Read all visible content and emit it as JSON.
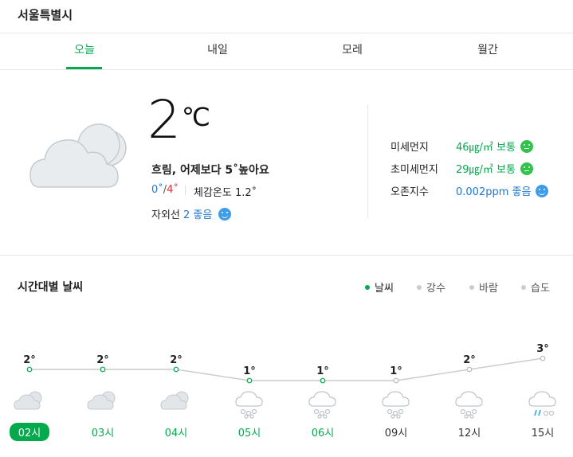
{
  "location": "서울특별시",
  "tabs": [
    {
      "label": "오늘",
      "active": true
    },
    {
      "label": "내일",
      "active": false
    },
    {
      "label": "모레",
      "active": false
    },
    {
      "label": "월간",
      "active": false
    }
  ],
  "current": {
    "icon": "cloudy-icon",
    "temperature": "2",
    "unit": "℃",
    "summary": "흐림, 어제보다 5˚높아요",
    "min_temp": "0˚",
    "slash": "/",
    "max_temp": "4˚",
    "feels_like": "체감온도 1.2˚",
    "uv_label": "자외선",
    "uv_value": "2 좋음"
  },
  "air_quality": [
    {
      "label": "미세먼지",
      "value": "46㎍/㎥ 보통",
      "status": "normal",
      "color": "#32c24d"
    },
    {
      "label": "초미세먼지",
      "value": "29㎍/㎥ 보통",
      "status": "normal",
      "color": "#32c24d"
    },
    {
      "label": "오존지수",
      "value": "0.002ppm 좋음",
      "status": "good",
      "color": "#3f9de8"
    }
  ],
  "hourly": {
    "title": "시간대별 날씨",
    "legend": [
      {
        "label": "날씨",
        "active": true
      },
      {
        "label": "강수",
        "active": false
      },
      {
        "label": "바람",
        "active": false
      },
      {
        "label": "습도",
        "active": false
      }
    ]
  },
  "chart_data": {
    "type": "line",
    "categories": [
      "02시",
      "03시",
      "04시",
      "05시",
      "06시",
      "09시",
      "12시",
      "15시"
    ],
    "values": [
      2,
      2,
      2,
      1,
      1,
      1,
      2,
      3
    ],
    "value_labels": [
      "2°",
      "2°",
      "2°",
      "1°",
      "1°",
      "1°",
      "2°",
      "3°"
    ],
    "icons": [
      "cloudy-icon",
      "cloudy-icon",
      "cloudy-icon",
      "snow-icon",
      "snow-icon",
      "snow-icon",
      "snow-icon",
      "rain-snow-icon"
    ],
    "current_index": 0,
    "today_indices": [
      0,
      1,
      2,
      3,
      4
    ],
    "line_color": "#cccccc",
    "point_color": "#03a94d",
    "title": "",
    "xlabel": "",
    "ylabel": ""
  }
}
